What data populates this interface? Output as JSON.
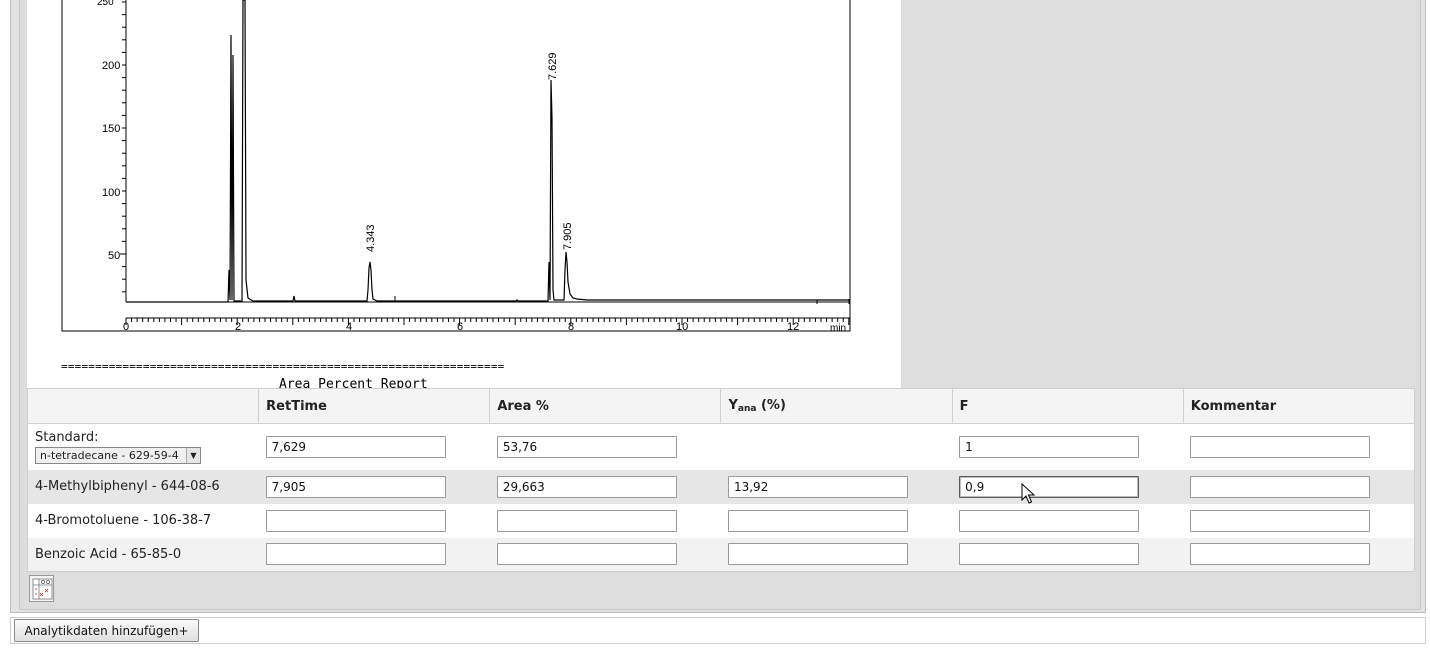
{
  "chromatogram": {
    "y_ticks": [
      "50",
      "100",
      "150",
      "200",
      "250"
    ],
    "x_ticks": [
      "0",
      "2",
      "4",
      "6",
      "8",
      "10",
      "12"
    ],
    "x_unit": "min",
    "peak_labels": [
      "4.343",
      "7.629",
      "7.905"
    ],
    "separator_line": "=================================================================",
    "report_title": "Area Percent Report"
  },
  "table": {
    "headers": {
      "col0": "",
      "rettime": "RetTime",
      "area": "Area %",
      "yana_main": "Y",
      "yana_sub": "ana",
      "yana_unit": " (%)",
      "f": "F",
      "kommentar": "Kommentar"
    },
    "standard": {
      "label": "Standard:",
      "select_value": "n-tetradecane - 629-59-4",
      "rettime": "7,629",
      "area": "53,76",
      "f": "1",
      "kommentar": ""
    },
    "rows": [
      {
        "name": "4-Methylbiphenyl - 644-08-6",
        "rettime": "7,905",
        "area": "29,663",
        "yana": "13,92",
        "f": "0,9",
        "kommentar": ""
      },
      {
        "name": "4-Bromotoluene - 106-38-7",
        "rettime": "",
        "area": "",
        "yana": "",
        "f": "",
        "kommentar": ""
      },
      {
        "name": "Benzoic Acid - 65-85-0",
        "rettime": "",
        "area": "",
        "yana": "",
        "f": "",
        "kommentar": ""
      }
    ]
  },
  "buttons": {
    "add_analytics": "Analytikdaten hinzufügen+"
  },
  "icons": {
    "table_icon": "table-settings-icon",
    "cursor": "mouse-pointer-icon"
  }
}
